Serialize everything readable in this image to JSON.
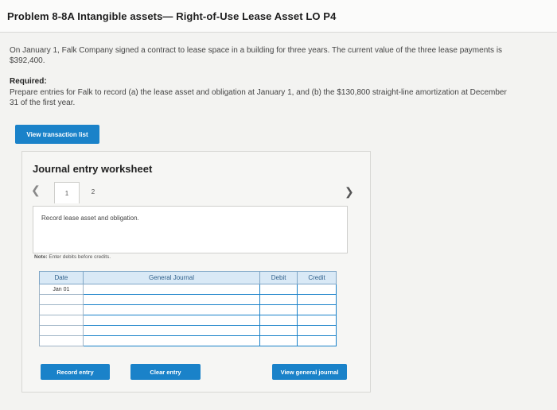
{
  "header": {
    "title": "Problem 8-8A Intangible assets— Right-of-Use Lease Asset LO P4"
  },
  "problem": {
    "description": "On January 1, Falk Company signed a contract to lease space in a building for three years. The current value of the three lease payments is $392,400.",
    "required_label": "Required:",
    "required_text": "Prepare entries for Falk to record (a) the lease asset and obligation at January 1, and (b) the $130,800 straight-line amortization at December 31 of the first year."
  },
  "buttons": {
    "view_transaction_list": "View transaction list",
    "record_entry": "Record entry",
    "clear_entry": "Clear entry",
    "view_general_journal": "View general journal"
  },
  "worksheet": {
    "title": "Journal entry worksheet",
    "tabs": [
      "1",
      "2"
    ],
    "active_tab": "1",
    "prev_icon": "chevron-left-icon",
    "next_icon": "chevron-right-icon",
    "entry_description": "Record lease asset and obligation.",
    "note_label": "Note:",
    "note_text": "Enter debits before credits.",
    "table": {
      "headers": [
        "Date",
        "General Journal",
        "Debit",
        "Credit"
      ],
      "rows": [
        {
          "date": "Jan 01",
          "account": "",
          "debit": "",
          "credit": ""
        },
        {
          "date": "",
          "account": "",
          "debit": "",
          "credit": ""
        },
        {
          "date": "",
          "account": "",
          "debit": "",
          "credit": ""
        },
        {
          "date": "",
          "account": "",
          "debit": "",
          "credit": ""
        },
        {
          "date": "",
          "account": "",
          "debit": "",
          "credit": ""
        },
        {
          "date": "",
          "account": "",
          "debit": "",
          "credit": ""
        }
      ]
    }
  },
  "colors": {
    "accent": "#1a82c9",
    "table_header_bg": "#d9e9f6"
  }
}
